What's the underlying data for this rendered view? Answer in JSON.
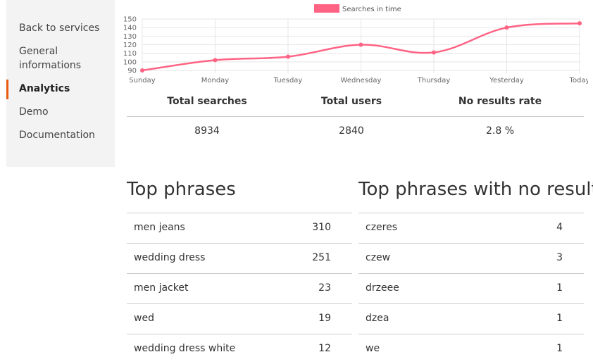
{
  "sidebar": {
    "items": [
      {
        "label": "Back to services",
        "active": false
      },
      {
        "label": "General informations",
        "active": false
      },
      {
        "label": "Analytics",
        "active": true
      },
      {
        "label": "Demo",
        "active": false
      },
      {
        "label": "Documentation",
        "active": false
      }
    ]
  },
  "colors": {
    "accent": "#e8590c",
    "series": "#ff6384",
    "sidebar_bg": "#f3f3f3"
  },
  "chart_data": {
    "type": "line",
    "categories": [
      "Sunday",
      "Monday",
      "Tuesday",
      "Wednesday",
      "Thursday",
      "Yesterday",
      "Today"
    ],
    "series": [
      {
        "name": "Searches in time",
        "values": [
          90,
          102,
          106,
          120,
          111,
          140,
          145
        ],
        "color": "#ff6384"
      }
    ],
    "yticks": [
      90,
      100,
      110,
      120,
      130,
      140,
      150
    ],
    "ylim": [
      90,
      150
    ],
    "grid": true,
    "legend": "top-center"
  },
  "stats": {
    "columns": [
      {
        "label": "Total searches",
        "value": "8934"
      },
      {
        "label": "Total users",
        "value": "2840"
      },
      {
        "label": "No results rate",
        "value": "2.8 %"
      }
    ]
  },
  "top_phrases": {
    "title": "Top phrases",
    "rows": [
      {
        "phrase": "men jeans",
        "count": "310"
      },
      {
        "phrase": "wedding dress",
        "count": "251"
      },
      {
        "phrase": "men jacket",
        "count": "23"
      },
      {
        "phrase": "wed",
        "count": "19"
      },
      {
        "phrase": "wedding dress white",
        "count": "12"
      }
    ]
  },
  "no_results": {
    "title": "Top phrases with no results",
    "rows": [
      {
        "phrase": "czeres",
        "count": "4"
      },
      {
        "phrase": "czew",
        "count": "3"
      },
      {
        "phrase": "drzeee",
        "count": "1"
      },
      {
        "phrase": "dzea",
        "count": "1"
      },
      {
        "phrase": "we",
        "count": "1"
      }
    ]
  }
}
